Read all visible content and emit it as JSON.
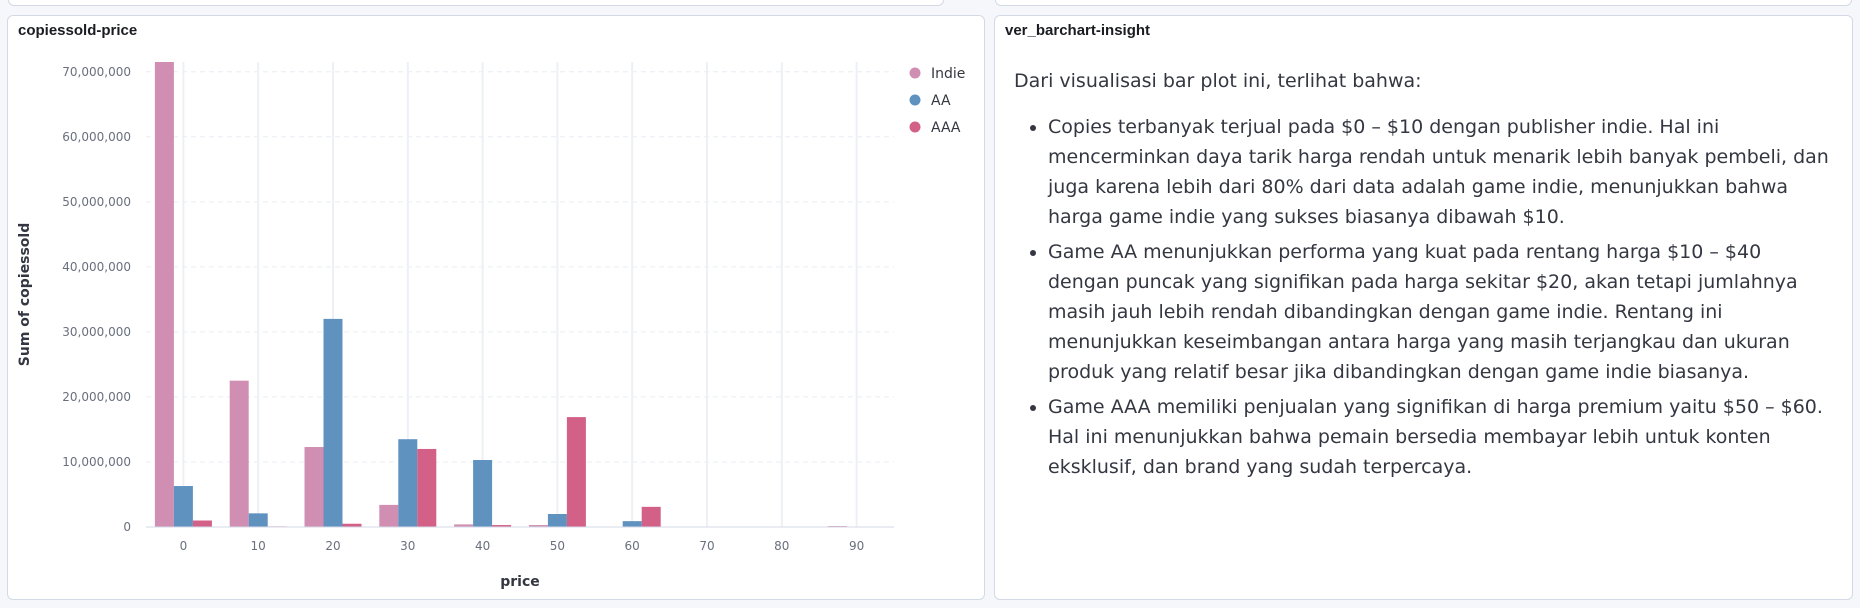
{
  "chart_panel": {
    "title": "copiessold-price"
  },
  "insight_panel": {
    "title": "ver_barchart-insight",
    "intro": "Dari visualisasi bar plot ini, terlihat bahwa:",
    "bullets": [
      "Copies terbanyak terjual pada $0 – $10 dengan publisher indie. Hal ini mencerminkan daya tarik harga rendah untuk menarik lebih banyak pembeli, dan juga karena lebih dari 80% dari data adalah game indie, menunjukkan bahwa harga game indie yang sukses biasanya dibawah $10.",
      "Game AA menunjukkan performa yang kuat pada rentang harga $10 – $40 dengan puncak yang signifikan pada harga sekitar $20, akan tetapi jumlahnya masih jauh lebih rendah dibandingkan dengan game indie. Rentang ini menunjukkan keseimbangan antara harga yang masih terjangkau dan ukuran produk yang relatif besar jika dibandingkan dengan game indie biasanya.",
      "Game AAA memiliki penjualan yang signifikan di harga premium yaitu $50 – $60. Hal ini menunjukkan bahwa pemain bersedia membayar lebih untuk konten eksklusif, dan brand yang sudah terpercaya."
    ]
  },
  "chart_data": {
    "type": "bar",
    "title": "",
    "xlabel": "price",
    "ylabel": "Sum of copiessold",
    "categories": [
      "0",
      "10",
      "20",
      "30",
      "40",
      "50",
      "60",
      "70",
      "80",
      "90"
    ],
    "series": [
      {
        "name": "Indie",
        "color": "#d08fb2",
        "values": [
          71500000,
          22500000,
          12300000,
          3400000,
          400000,
          300000,
          0,
          0,
          0,
          150000
        ]
      },
      {
        "name": "AA",
        "color": "#6092c0",
        "values": [
          6300000,
          2100000,
          32000000,
          13500000,
          10300000,
          2000000,
          900000,
          0,
          0,
          0
        ]
      },
      {
        "name": "AAA",
        "color": "#d36086",
        "values": [
          1000000,
          100000,
          500000,
          12000000,
          300000,
          16900000,
          3100000,
          0,
          0,
          0
        ]
      }
    ],
    "yticks": [
      0,
      10000000,
      20000000,
      30000000,
      40000000,
      50000000,
      60000000,
      70000000
    ],
    "ytick_labels": [
      "0",
      "10,000,000",
      "20,000,000",
      "30,000,000",
      "40,000,000",
      "50,000,000",
      "60,000,000",
      "70,000,000"
    ],
    "ylim": [
      0,
      71500000
    ],
    "grid": true,
    "legend_position": "top-right"
  }
}
